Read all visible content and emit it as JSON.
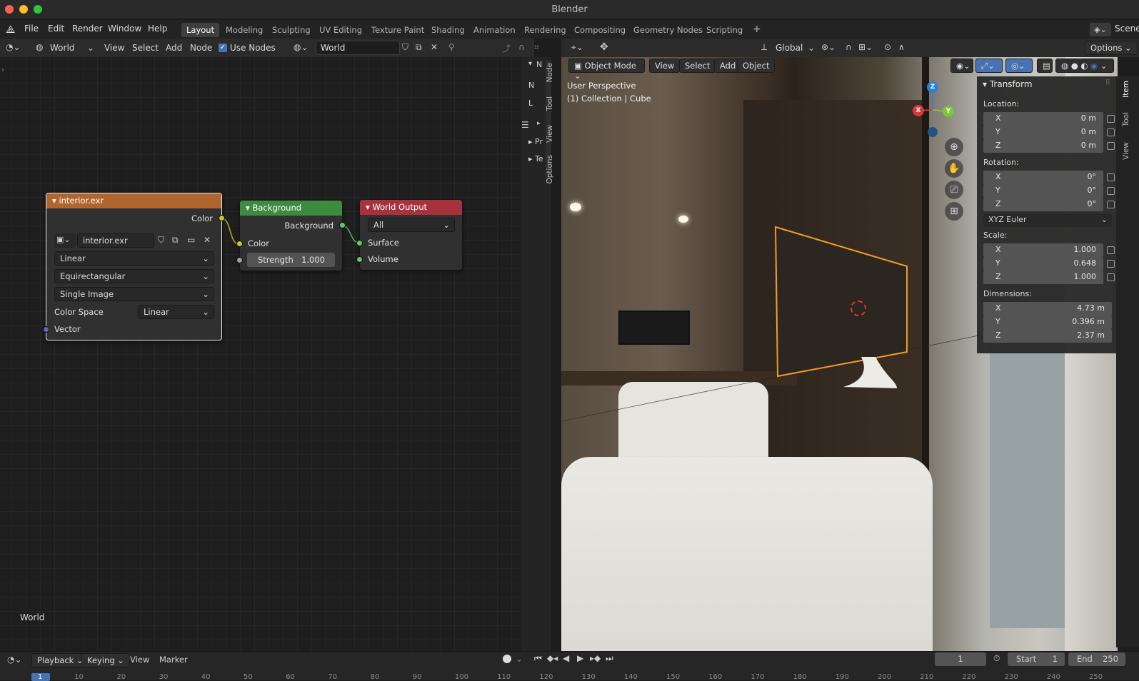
{
  "window": {
    "title": "Blender"
  },
  "menu": {
    "items": [
      "File",
      "Edit",
      "Render",
      "Window",
      "Help"
    ]
  },
  "workspaces": [
    "Layout",
    "Modeling",
    "Sculpting",
    "UV Editing",
    "Texture Paint",
    "Shading",
    "Animation",
    "Rendering",
    "Compositing",
    "Geometry Nodes",
    "Scripting",
    "+"
  ],
  "scene_label": "Scene",
  "node_editor": {
    "shader_type": "World",
    "menus": [
      "View",
      "Select",
      "Add",
      "Node"
    ],
    "use_nodes_label": "Use Nodes",
    "use_nodes_checked": true,
    "world_name": "World",
    "overlay_label": "World",
    "sidebar_rows": [
      "N",
      "L",
      "Pr",
      "Te"
    ],
    "sidebar_tabs": [
      "Node",
      "Tool",
      "View",
      "Options"
    ]
  },
  "nodes": {
    "image": {
      "title": "interior.exr",
      "output": "Color",
      "image_name": "interior.exr",
      "interpolation": "Linear",
      "projection": "Equirectangular",
      "source": "Single Image",
      "color_space_label": "Color Space",
      "color_space": "Linear",
      "input": "Vector"
    },
    "background": {
      "title": "Background",
      "output": "Background",
      "input_color": "Color",
      "strength_label": "Strength",
      "strength_value": "1.000"
    },
    "output": {
      "title": "World Output",
      "target": "All",
      "input_surface": "Surface",
      "input_volume": "Volume"
    }
  },
  "viewport_header": {
    "orientation": "Global",
    "options": "Options",
    "mode": "Object Mode",
    "menus": [
      "View",
      "Select",
      "Add",
      "Object"
    ]
  },
  "viewport": {
    "perspective": "User Perspective",
    "collection": "(1) Collection | Cube",
    "gizmo": {
      "x": "X",
      "y": "Y",
      "z": "Z"
    }
  },
  "n_panel": {
    "section": "Transform",
    "location_label": "Location:",
    "location": [
      {
        "k": "X",
        "v": "0 m"
      },
      {
        "k": "Y",
        "v": "0 m"
      },
      {
        "k": "Z",
        "v": "0 m"
      }
    ],
    "rotation_label": "Rotation:",
    "rotation": [
      {
        "k": "X",
        "v": "0°"
      },
      {
        "k": "Y",
        "v": "0°"
      },
      {
        "k": "Z",
        "v": "0°"
      }
    ],
    "rotation_mode": "XYZ Euler",
    "scale_label": "Scale:",
    "scale": [
      {
        "k": "X",
        "v": "1.000"
      },
      {
        "k": "Y",
        "v": "0.648"
      },
      {
        "k": "Z",
        "v": "1.000"
      }
    ],
    "dimensions_label": "Dimensions:",
    "dimensions": [
      {
        "k": "X",
        "v": "4.73 m"
      },
      {
        "k": "Y",
        "v": "0.396 m"
      },
      {
        "k": "Z",
        "v": "2.37 m"
      }
    ],
    "tabs": [
      "Item",
      "Tool",
      "View"
    ]
  },
  "timeline": {
    "menus": [
      "Playback",
      "Keying",
      "View",
      "Marker"
    ],
    "current_frame": "1",
    "start_label": "Start",
    "start": "1",
    "end_label": "End",
    "end": "250",
    "ruler": [
      "1",
      "10",
      "20",
      "30",
      "40",
      "50",
      "60",
      "70",
      "80",
      "90",
      "100",
      "110",
      "120",
      "130",
      "140",
      "150",
      "160",
      "170",
      "180",
      "190",
      "200",
      "210",
      "220",
      "230",
      "240",
      "250"
    ]
  }
}
